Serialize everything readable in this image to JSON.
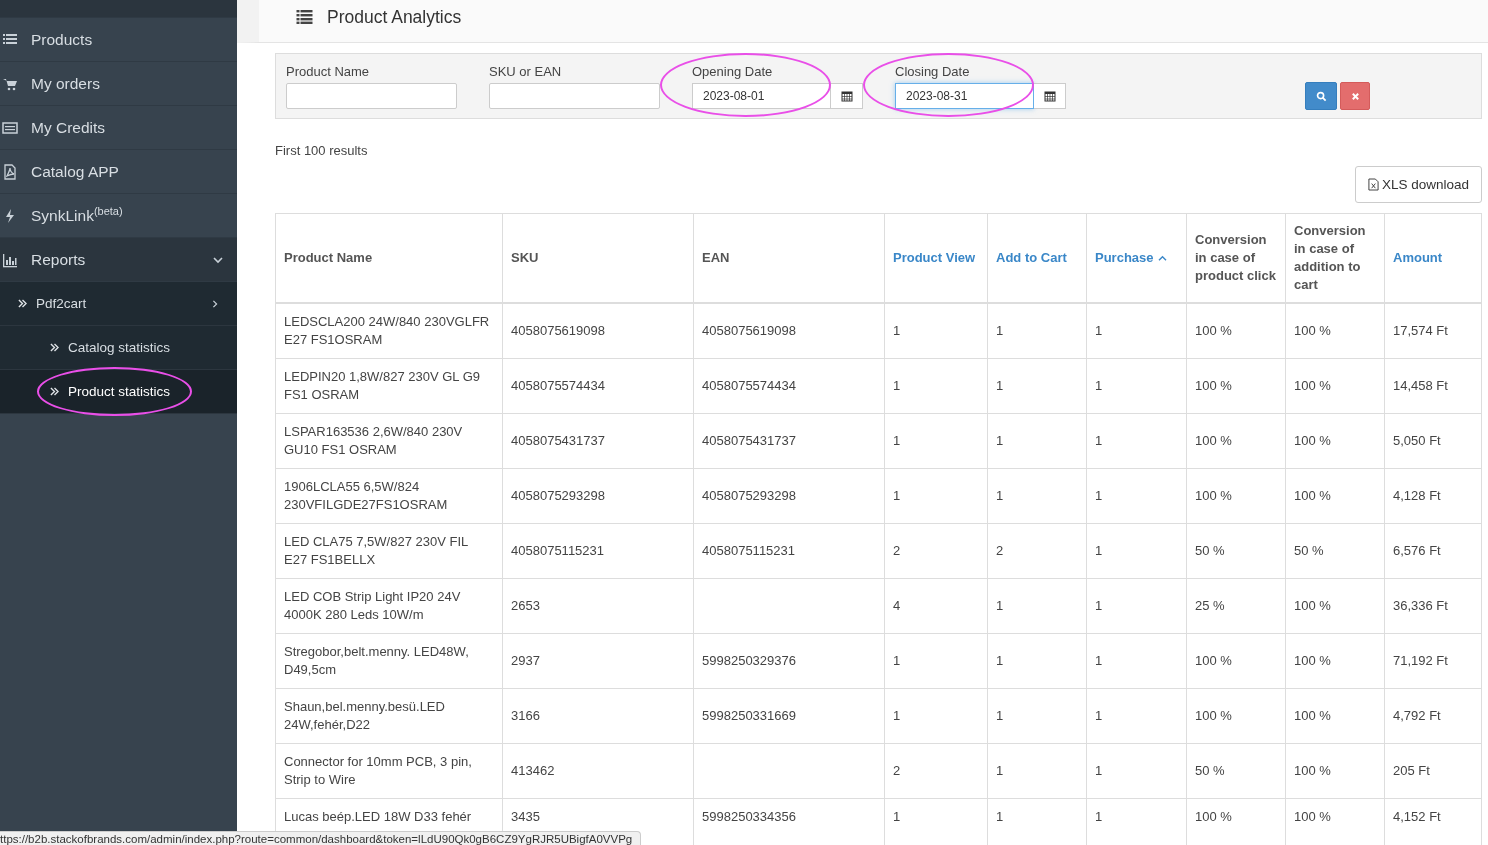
{
  "sidebar": {
    "items": [
      {
        "label": "Products",
        "selected": false
      },
      {
        "label": "My orders",
        "selected": false
      },
      {
        "label": "My Credits",
        "selected": false
      },
      {
        "label": "Catalog APP",
        "selected": false
      },
      {
        "label": "SynkLink$^{(beta)}$",
        "selected": false
      },
      {
        "label": "Reports",
        "selected": false,
        "expanded": true,
        "children": [
          {
            "label": "Pdf2cart",
            "selected": false,
            "children": [
              {
                "label": "Catalog statistics",
                "selected": false,
                "highlighted": false
              },
              {
                "label": "Product statistics",
                "selected": true,
                "highlighted": true
              }
            ]
          }
        ]
      }
    ]
  },
  "page": {
    "title": "Product Analytics"
  },
  "filters": [
    {
      "kind": "text",
      "label": "Product Name"
    },
    {
      "kind": "text",
      "label": "SKU or EAN"
    },
    {
      "kind": "date",
      "label": "Opening Date",
      "value": "2023-08-01",
      "highlighted": true,
      "focused": false
    },
    {
      "kind": "date",
      "label": "Closing Date",
      "value": "2023-08-31",
      "highlighted": true,
      "focused": true
    }
  ],
  "results_note": "First 100 results",
  "download_button": "XLS download",
  "table": {
    "columns": [
      {
        "label": "Product Name",
        "sortable": false
      },
      {
        "label": "SKU",
        "sortable": false
      },
      {
        "label": "EAN",
        "sortable": false
      },
      {
        "label": "Product View",
        "sortable": true,
        "sorted": false
      },
      {
        "label": "Add to Cart",
        "sortable": true,
        "sorted": false
      },
      {
        "label": "Purchase",
        "sortable": true,
        "sorted": true
      },
      {
        "label": "Conversion in case of product click",
        "sortable": false
      },
      {
        "label": "Conversion in case of addition to cart",
        "sortable": false
      },
      {
        "label": "Amount",
        "sortable": true,
        "sorted": false
      }
    ],
    "rows": [
      [
        "LEDSCLA200 24W/840 230VGLFR E27 FS1OSRAM",
        "4058075619098",
        "4058075619098",
        "1",
        "1",
        "1",
        "100 %",
        "100 %",
        "17,574 Ft"
      ],
      [
        "LEDPIN20 1,8W/827 230V GL G9 FS1 OSRAM",
        "4058075574434",
        "4058075574434",
        "1",
        "1",
        "1",
        "100 %",
        "100 %",
        "14,458 Ft"
      ],
      [
        "LSPAR163536 2,6W/840 230V GU10 FS1 OSRAM",
        "4058075431737",
        "4058075431737",
        "1",
        "1",
        "1",
        "100 %",
        "100 %",
        "5,050 Ft"
      ],
      [
        "1906LCLA55 6,5W/824 230VFILGDE27FS1OSRAM",
        "4058075293298",
        "4058075293298",
        "1",
        "1",
        "1",
        "100 %",
        "100 %",
        "4,128 Ft"
      ],
      [
        "LED CLA75 7,5W/827 230V FIL E27 FS1BELLX",
        "4058075115231",
        "4058075115231",
        "2",
        "2",
        "1",
        "50 %",
        "50 %",
        "6,576 Ft"
      ],
      [
        "LED COB Strip Light IP20 24V 4000K 280 Leds 10W/m",
        "2653",
        "",
        "4",
        "1",
        "1",
        "25 %",
        "100 %",
        "36,336 Ft"
      ],
      [
        "Stregobor,belt.menny. LED48W, D49,5cm",
        "2937",
        "5998250329376",
        "1",
        "1",
        "1",
        "100 %",
        "100 %",
        "71,192 Ft"
      ],
      [
        "Shaun,bel.menny.besü.LED 24W,fehér,D22",
        "3166",
        "5998250331669",
        "1",
        "1",
        "1",
        "100 %",
        "100 %",
        "4,792 Ft"
      ],
      [
        "Connector for 10mm PCB, 3 pin, Strip to Wire",
        "413462",
        "",
        "2",
        "1",
        "1",
        "50 %",
        "100 %",
        "205 Ft"
      ],
      [
        "Lucas beép.LED 18W D33 fehér",
        "3435",
        "5998250334356",
        "1",
        "1",
        "1",
        "100 %",
        "100 %",
        "4,152 Ft"
      ]
    ]
  },
  "status_bar": "ttps://b2b.stackofbrands.com/admin/index.php?route=common/dashboard&token=lLdU90Qk0gB6CZ9YgRJR5UBigfA0VVPg"
}
